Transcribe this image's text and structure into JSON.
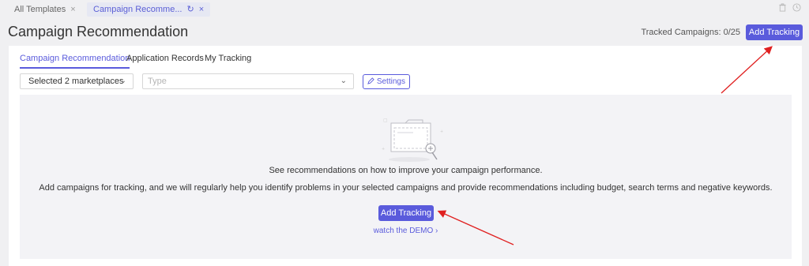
{
  "tabs": [
    {
      "label": "All Templates",
      "close": "×"
    },
    {
      "label": "Campaign Recomme...",
      "refresh": "↻",
      "close": "×"
    }
  ],
  "header": {
    "title": "Campaign Recommendation",
    "tracked": "Tracked Campaigns: 0/25",
    "add_tracking": "Add Tracking"
  },
  "subtabs": [
    "Campaign Recommendation",
    "Application Records",
    "My Tracking"
  ],
  "filters": {
    "marketplaces": "Selected 2 marketplaces",
    "type_placeholder": "Type",
    "settings": "Settings",
    "chevron": "⌄"
  },
  "empty": {
    "line1": "See recommendations on how to improve your campaign performance.",
    "line2": "Add campaigns for tracking, and we will regularly help you identify problems in your selected campaigns and provide recommendations including budget, search terms and negative keywords.",
    "button": "Add Tracking",
    "demo": "watch the DEMO ›"
  },
  "colors": {
    "accent": "#5a5bdc",
    "annotation": "#e02020"
  },
  "icons": {
    "trash": "trash-icon",
    "clock": "clock-icon",
    "edit": "edit-icon",
    "refresh": "refresh-icon"
  }
}
